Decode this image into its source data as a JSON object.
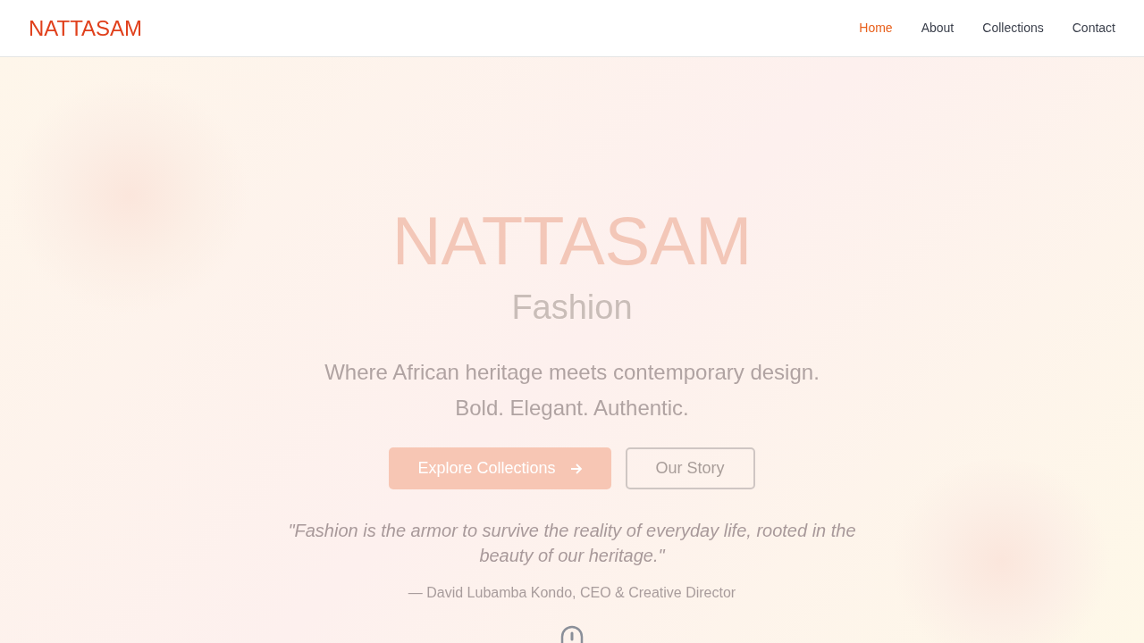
{
  "brand": "NATTASAM",
  "nav": [
    {
      "label": "Home",
      "selected": true
    },
    {
      "label": "About",
      "selected": false
    },
    {
      "label": "Collections",
      "selected": false
    },
    {
      "label": "Contact",
      "selected": false
    }
  ],
  "hero": {
    "title": "NATTASAM",
    "subtitle": "Fashion",
    "tagline": [
      "Where African heritage meets contemporary design.",
      "Bold. Elegant. Authentic."
    ],
    "buttons": [
      {
        "label": "Explore Collections",
        "kind": "primary"
      },
      {
        "label": "Our Story",
        "kind": "outline"
      }
    ],
    "quote": "\"Fashion is the armor to survive the reality of everyday life, rooted in the beauty of our heritage.\"",
    "attribution": "— David Lubamba Kondo, CEO & Creative Director"
  }
}
